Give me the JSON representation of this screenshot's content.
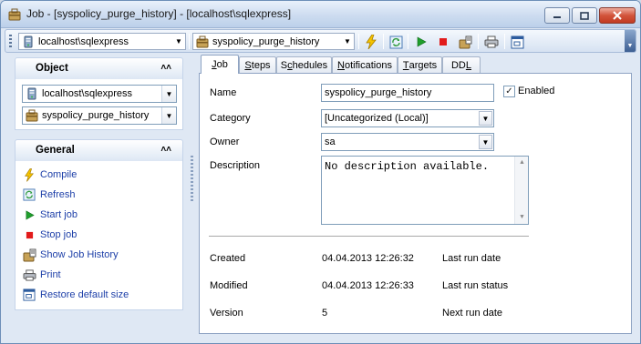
{
  "window": {
    "title": "Job - [syspolicy_purge_history] - [localhost\\sqlexpress]"
  },
  "toolbar": {
    "server_combo": "localhost\\sqlexpress",
    "job_combo": "syspolicy_purge_history",
    "buttons": [
      "compile-icon",
      "refresh-icon",
      "start-job-icon",
      "stop-job-icon",
      "job-history-icon",
      "print-icon",
      "restore-size-icon"
    ]
  },
  "sidebar": {
    "object_header": "Object",
    "server_combo": "localhost\\sqlexpress",
    "job_combo": "syspolicy_purge_history",
    "general_header": "General",
    "actions": [
      {
        "label": "Compile",
        "icon": "compile-icon"
      },
      {
        "label": "Refresh",
        "icon": "refresh-icon"
      },
      {
        "label": "Start job",
        "icon": "start-job-icon"
      },
      {
        "label": "Stop job",
        "icon": "stop-job-icon"
      },
      {
        "label": "Show Job History",
        "icon": "job-history-icon"
      },
      {
        "label": "Print",
        "icon": "print-icon"
      },
      {
        "label": "Restore default size",
        "icon": "restore-size-icon"
      }
    ]
  },
  "tabs": [
    {
      "pre": "",
      "key": "J",
      "post": "ob"
    },
    {
      "pre": "",
      "key": "S",
      "post": "teps"
    },
    {
      "pre": "S",
      "key": "c",
      "post": "hedules"
    },
    {
      "pre": "",
      "key": "N",
      "post": "otifications"
    },
    {
      "pre": "",
      "key": "T",
      "post": "argets"
    },
    {
      "pre": "DD",
      "key": "L",
      "post": ""
    }
  ],
  "job": {
    "name_label": "Name",
    "name_value": "syspolicy_purge_history",
    "enabled_label": "Enabled",
    "enabled": true,
    "category_label": "Category",
    "category_value": "[Uncategorized (Local)]",
    "owner_label": "Owner",
    "owner_value": "sa",
    "description_label": "Description",
    "description_value": "No description available.",
    "created_label": "Created",
    "created_value": "04.04.2013 12:26:32",
    "modified_label": "Modified",
    "modified_value": "04.04.2013 12:26:33",
    "version_label": "Version",
    "version_value": "5",
    "last_run_date_label": "Last run date",
    "last_run_status_label": "Last run status",
    "next_run_date_label": "Next run date"
  },
  "colors": {
    "link": "#1d3fa8",
    "titlebar": "#cddcf0",
    "close_button": "#d2543b"
  }
}
